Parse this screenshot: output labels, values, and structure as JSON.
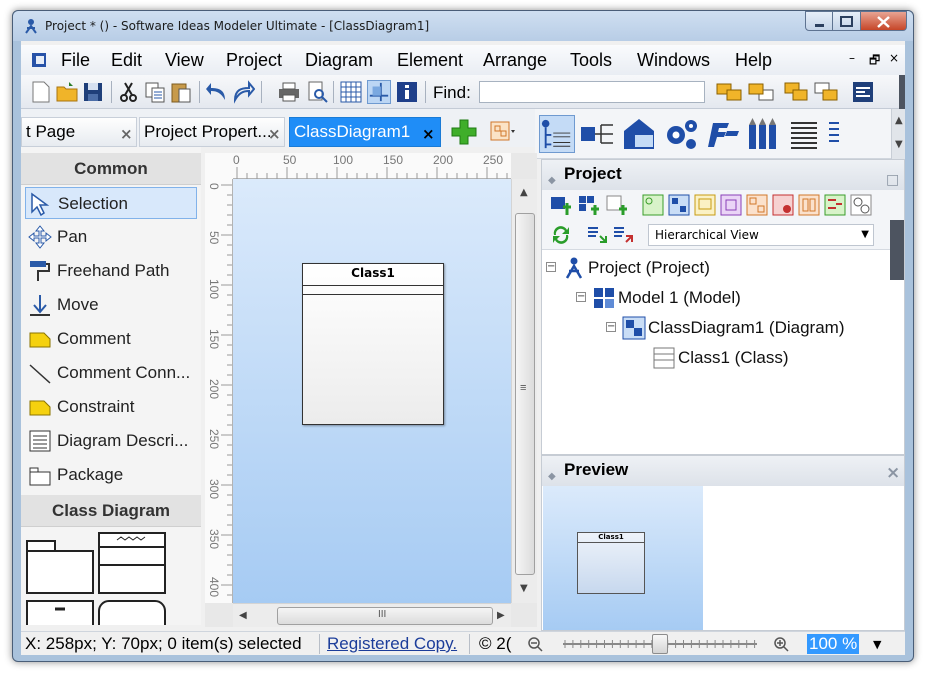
{
  "window": {
    "title": "Project * ()  - Software Ideas Modeler Ultimate - [ClassDiagram1]"
  },
  "menu": {
    "items": [
      "File",
      "Edit",
      "View",
      "Project",
      "Diagram",
      "Element",
      "Arrange",
      "Tools",
      "Windows",
      "Help"
    ],
    "mdi_minimize": "–",
    "mdi_restore": "🗗",
    "mdi_close": "×"
  },
  "toolbar": {
    "find_label": "Find:",
    "find_value": ""
  },
  "tabs": [
    {
      "label": "t Page",
      "close": "×",
      "active": false
    },
    {
      "label": "Project Propert...",
      "close": "×",
      "active": false
    },
    {
      "label": "ClassDiagram1",
      "close": "×",
      "active": true
    }
  ],
  "toolbox": {
    "common_header": "Common",
    "common_items": [
      "Selection",
      "Pan",
      "Freehand Path",
      "Move",
      "Comment",
      "Comment Conn...",
      "Constraint",
      "Diagram Descri...",
      "Package"
    ],
    "class_header": "Class Diagram"
  },
  "canvas": {
    "ruler_top": [
      "0",
      "50",
      "100",
      "150",
      "200",
      "250"
    ],
    "ruler_left": [
      "0",
      "50",
      "100",
      "150",
      "200",
      "250",
      "300",
      "350",
      "400"
    ],
    "class_name": "Class1",
    "hscroll_grip": "III",
    "vscroll_grip": "≡"
  },
  "project_panel": {
    "title": "Project",
    "view_mode": "Hierarchical View",
    "tree": [
      {
        "label": "Project (Project)",
        "level": 0,
        "expander": "−"
      },
      {
        "label": "Model 1 (Model)",
        "level": 1,
        "expander": "−"
      },
      {
        "label": "ClassDiagram1 (Diagram)",
        "level": 2,
        "expander": "−"
      },
      {
        "label": "Class1 (Class)",
        "level": 3,
        "expander": ""
      }
    ]
  },
  "preview_panel": {
    "title": "Preview",
    "class_name": "Class1"
  },
  "status": {
    "coords": "X: 258px; Y: 70px; 0 item(s) selected",
    "registered": "Registered Copy.",
    "copyright": "© 2(",
    "zoom": "100 %",
    "zoom_level": 0.5
  },
  "colors": {
    "active_tab": "#1f8df7",
    "canvas_top": "#dbeafb",
    "canvas_bottom": "#a6cbf3",
    "zoom_highlight": "#3399ff"
  }
}
